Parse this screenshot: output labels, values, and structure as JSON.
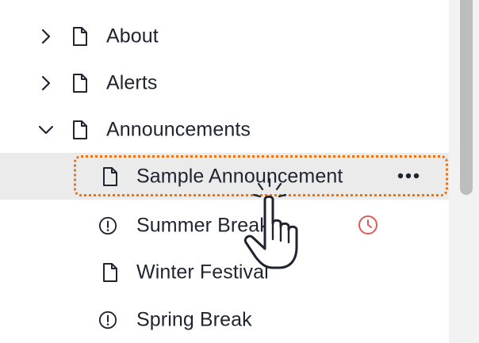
{
  "tree": {
    "items": [
      {
        "label": "About",
        "expanded": false,
        "icon": "page-icon"
      },
      {
        "label": "Alerts",
        "expanded": false,
        "icon": "page-icon"
      },
      {
        "label": "Announcements",
        "expanded": true,
        "icon": "page-icon"
      }
    ],
    "children": [
      {
        "label": "Sample Announcement",
        "icon": "page-icon",
        "selected": true
      },
      {
        "label": "Summer Break",
        "icon": "alert-circle-icon",
        "scheduled": true
      },
      {
        "label": "Winter Festival",
        "icon": "page-icon"
      },
      {
        "label": "Spring Break",
        "icon": "alert-circle-icon"
      }
    ]
  },
  "colors": {
    "focus_ring": "#e2761c",
    "schedule_clock": "#e05a5a",
    "selected_row_bg": "#ebebeb",
    "text": "#1f2430"
  }
}
